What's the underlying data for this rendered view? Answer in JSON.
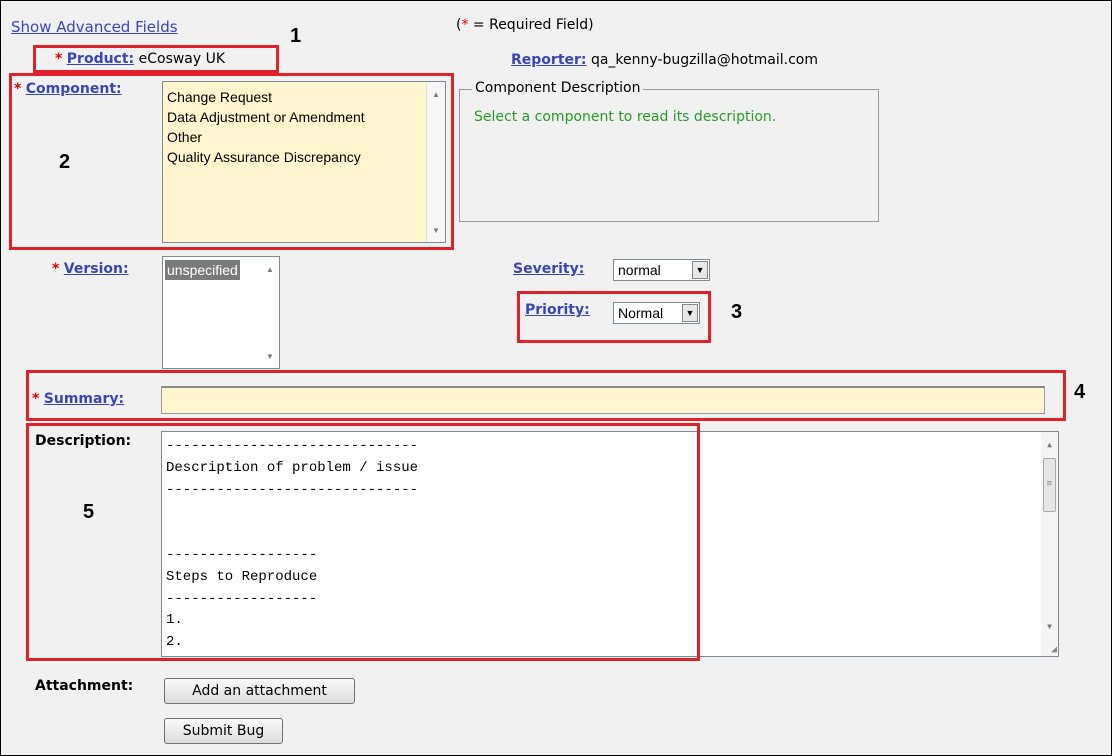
{
  "top": {
    "show_advanced": "Show Advanced Fields",
    "required_note_prefix": "(",
    "required_star": "*",
    "required_note_suffix": " = Required Field)"
  },
  "fields": {
    "product": {
      "star": "*",
      "label": "Product:",
      "value": "eCosway UK"
    },
    "reporter": {
      "label": "Reporter:",
      "value": "qa_kenny-bugzilla@hotmail.com"
    },
    "component": {
      "star": "*",
      "label": "Component:",
      "options": [
        "Change Request",
        "Data Adjustment or Amendment",
        "Other",
        "Quality Assurance Discrepancy"
      ]
    },
    "component_description": {
      "legend": "Component Description",
      "text": "Select a component to read its description."
    },
    "version": {
      "star": "*",
      "label": "Version:",
      "options": [
        "unspecified"
      ]
    },
    "severity": {
      "label": "Severity:",
      "value": "normal"
    },
    "priority": {
      "label": "Priority:",
      "value": "Normal"
    },
    "summary": {
      "star": "*",
      "label": "Summary:",
      "value": ""
    },
    "description": {
      "label": "Description:",
      "lines": [
        "------------------------------",
        "Description of problem / issue",
        "------------------------------",
        "",
        "",
        "------------------",
        "Steps to Reproduce",
        "------------------",
        "1.",
        "2."
      ]
    },
    "attachment": {
      "label": "Attachment:",
      "button": "Add an attachment"
    },
    "submit": {
      "label": "Submit Bug"
    }
  },
  "annotations": [
    "1",
    "2",
    "3",
    "4",
    "5"
  ],
  "colors": {
    "annotation_red": "#e0202a",
    "link_blue": "#3a46b8",
    "required_red": "#e00000",
    "highlight_field": "#fff6cf",
    "description_green": "#2a9a2a"
  }
}
